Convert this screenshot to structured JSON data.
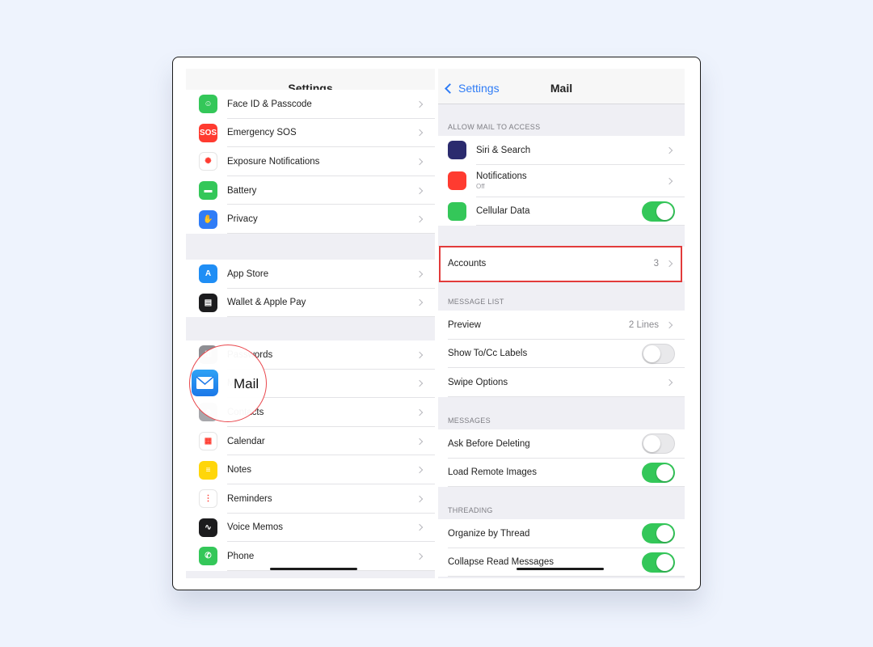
{
  "left_panel": {
    "title": "Settings",
    "group1": [
      {
        "label": "Face ID & Passcode",
        "icon": "face-id-icon",
        "color": "#34c759",
        "glyph": "☺"
      },
      {
        "label": "Emergency SOS",
        "icon": "sos-icon",
        "color": "#ff3b30",
        "glyph": "SOS"
      },
      {
        "label": "Exposure Notifications",
        "icon": "exposure-icon",
        "color": "#ffffff",
        "glyph": "✺"
      },
      {
        "label": "Battery",
        "icon": "battery-icon",
        "color": "#34c759",
        "glyph": "▬"
      },
      {
        "label": "Privacy",
        "icon": "hand-icon",
        "color": "#2f7cf6",
        "glyph": "✋"
      }
    ],
    "group2": [
      {
        "label": "App Store",
        "icon": "app-store-icon",
        "color": "#1f8ef5",
        "glyph": "A"
      },
      {
        "label": "Wallet & Apple Pay",
        "icon": "wallet-icon",
        "color": "#1c1c1e",
        "glyph": "▤"
      }
    ],
    "group3": [
      {
        "label": "Passwords",
        "icon": "key-icon",
        "color": "#8e8e93",
        "glyph": "⚿"
      },
      {
        "label": "Mail",
        "icon": "mail-icon",
        "color": "#2596f3",
        "glyph": "✉"
      },
      {
        "label": "Contacts",
        "icon": "contacts-icon",
        "color": "#a7a7ab",
        "glyph": "☻"
      },
      {
        "label": "Calendar",
        "icon": "calendar-icon",
        "color": "#ffffff",
        "glyph": "▦"
      },
      {
        "label": "Notes",
        "icon": "notes-icon",
        "color": "#ffd60a",
        "glyph": "≡"
      },
      {
        "label": "Reminders",
        "icon": "reminders-icon",
        "color": "#ffffff",
        "glyph": "⋮"
      },
      {
        "label": "Voice Memos",
        "icon": "voice-memos-icon",
        "color": "#1c1c1e",
        "glyph": "∿"
      },
      {
        "label": "Phone",
        "icon": "phone-icon",
        "color": "#34c759",
        "glyph": "✆"
      }
    ],
    "magnifier": {
      "label": "Mail",
      "icon": "mail-icon"
    }
  },
  "right_panel": {
    "back_label": "Settings",
    "title": "Mail",
    "section_access": "ALLOW MAIL TO ACCESS",
    "access_rows": [
      {
        "label": "Siri & Search",
        "icon": "siri-icon",
        "color": "#2b2b6e",
        "control": "chevron"
      },
      {
        "label": "Notifications",
        "sub": "Off",
        "icon": "notifications-icon",
        "color": "#ff3b30",
        "control": "chevron"
      },
      {
        "label": "Cellular Data",
        "icon": "cellular-icon",
        "color": "#34c759",
        "control": "toggle",
        "on": true
      }
    ],
    "accounts": {
      "label": "Accounts",
      "value": "3"
    },
    "section_message_list": "MESSAGE LIST",
    "message_list_rows": [
      {
        "label": "Preview",
        "value": "2 Lines",
        "control": "chevron"
      },
      {
        "label": "Show To/Cc Labels",
        "control": "toggle",
        "on": false
      },
      {
        "label": "Swipe Options",
        "control": "chevron"
      }
    ],
    "section_messages": "MESSAGES",
    "messages_rows": [
      {
        "label": "Ask Before Deleting",
        "control": "toggle",
        "on": false
      },
      {
        "label": "Load Remote Images",
        "control": "toggle",
        "on": true
      }
    ],
    "section_threading": "THREADING",
    "threading_rows": [
      {
        "label": "Organize by Thread",
        "control": "toggle",
        "on": true
      },
      {
        "label": "Collapse Read Messages",
        "control": "toggle",
        "on": true
      }
    ]
  },
  "colors": {
    "accent": "#2f7cf6",
    "toggle_on": "#34c759",
    "highlight": "#e23b3b"
  }
}
